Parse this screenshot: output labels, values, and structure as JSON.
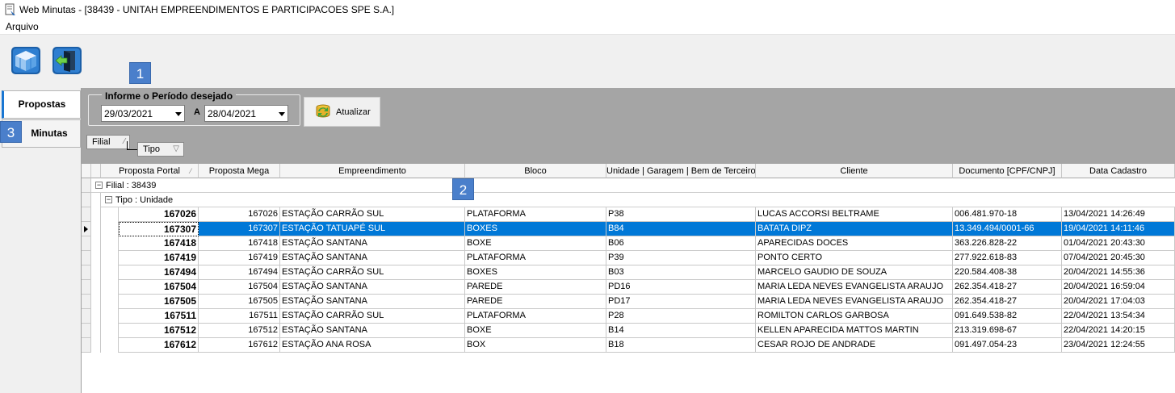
{
  "window": {
    "title": "Web Minutas - [38439 - UNITAH EMPREENDIMENTOS E PARTICIPACOES SPE S.A.]"
  },
  "menu": {
    "items": [
      "Arquivo"
    ]
  },
  "toolbar": {
    "buttons": [
      "building-icon",
      "exit-door-icon"
    ]
  },
  "callouts": [
    "1",
    "2",
    "3"
  ],
  "sidebar": {
    "tabs": [
      {
        "label": "Propostas",
        "active": true
      },
      {
        "label": "Minutas",
        "active": false
      }
    ]
  },
  "filter": {
    "legend": "Informe o Período desejado",
    "date_from": "29/03/2021",
    "separator": "A",
    "date_to": "28/04/2021",
    "refresh_label": "Atualizar",
    "group_chips": [
      "Filial",
      "Tipo"
    ]
  },
  "grid": {
    "columns": [
      "Proposta Portal",
      "Proposta Mega",
      "Empreendimento",
      "Bloco",
      "Unidade | Garagem | Bem de Terceiro",
      "Cliente",
      "Documento [CPF/CNPJ]",
      "Data Cadastro"
    ],
    "group1": "Filial : 38439",
    "group2": "Tipo : Unidade",
    "selected_index": 1,
    "rows": [
      [
        "167026",
        "167026",
        "ESTAÇÃO CARRÃO SUL",
        "PLATAFORMA",
        "P38",
        "LUCAS ACCORSI BELTRAME",
        "006.481.970-18",
        "13/04/2021 14:26:49"
      ],
      [
        "167307",
        "167307",
        "ESTAÇÃO TATUAPÉ SUL",
        "BOXES",
        "B84",
        "BATATA DIPZ",
        "13.349.494/0001-66",
        "19/04/2021 14:11:46"
      ],
      [
        "167418",
        "167418",
        "ESTAÇÃO SANTANA",
        "BOXE",
        "B06",
        "APARECIDAS DOCES",
        "363.226.828-22",
        "01/04/2021 20:43:30"
      ],
      [
        "167419",
        "167419",
        "ESTAÇÃO SANTANA",
        "PLATAFORMA",
        "P39",
        "PONTO CERTO",
        "277.922.618-83",
        "07/04/2021 20:45:30"
      ],
      [
        "167494",
        "167494",
        "ESTAÇÃO CARRÃO SUL",
        "BOXES",
        "B03",
        "MARCELO GAUDIO DE SOUZA",
        "220.584.408-38",
        "20/04/2021 14:55:36"
      ],
      [
        "167504",
        "167504",
        "ESTAÇÃO SANTANA",
        "PAREDE",
        "PD16",
        "MARIA LEDA NEVES EVANGELISTA ARAUJO",
        "262.354.418-27",
        "20/04/2021 16:59:04"
      ],
      [
        "167505",
        "167505",
        "ESTAÇÃO SANTANA",
        "PAREDE",
        "PD17",
        "MARIA LEDA NEVES EVANGELISTA ARAUJO",
        "262.354.418-27",
        "20/04/2021 17:04:03"
      ],
      [
        "167511",
        "167511",
        "ESTAÇÃO CARRÃO SUL",
        "PLATAFORMA",
        "P28",
        "ROMILTON CARLOS GARBOSA",
        "091.649.538-82",
        "22/04/2021 13:54:34"
      ],
      [
        "167512",
        "167512",
        "ESTAÇÃO SANTANA",
        "BOXE",
        "B14",
        "KELLEN APARECIDA MATTOS MARTIN",
        "213.319.698-67",
        "22/04/2021 14:20:15"
      ],
      [
        "167612",
        "167612",
        "ESTAÇÃO ANA ROSA",
        "BOX",
        "B18",
        "CESAR ROJO DE ANDRADE",
        "091.497.054-23",
        "23/04/2021 12:24:55"
      ]
    ]
  }
}
